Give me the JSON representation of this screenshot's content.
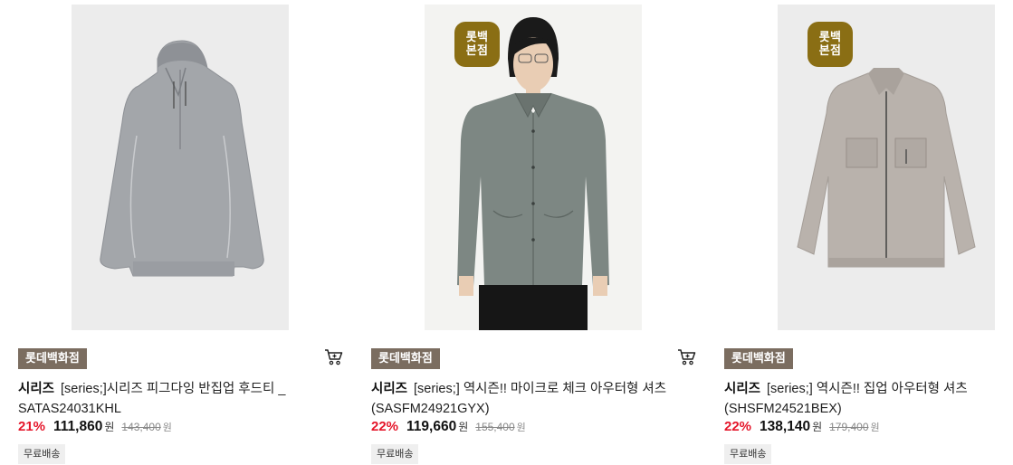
{
  "products": [
    {
      "store_badge": "",
      "seller": "롯데백화점",
      "brand": "시리즈",
      "name": "[series;]시리즈 피그다잉 반집업 후드티 _ SATAS24031KHL",
      "discount": "21%",
      "price": "111,860",
      "price_unit": "원",
      "original_price": "143,400",
      "original_unit": "원",
      "shipping": "무료배송"
    },
    {
      "store_badge": "롯백\n본점",
      "seller": "롯데백화점",
      "brand": "시리즈",
      "name": "[series;] 역시즌!! 마이크로 체크 아우터형 셔츠 (SASFM24921GYX)",
      "discount": "22%",
      "price": "119,660",
      "price_unit": "원",
      "original_price": "155,400",
      "original_unit": "원",
      "shipping": "무료배송"
    },
    {
      "store_badge": "롯백\n본점",
      "seller": "롯데백화점",
      "brand": "시리즈",
      "name": "[series;] 역시즌!! 집업 아우터형 셔츠 (SHSFM24521BEX)",
      "discount": "22%",
      "price": "138,140",
      "price_unit": "원",
      "original_price": "179,400",
      "original_unit": "원",
      "shipping": "무료배송"
    }
  ],
  "colors": {
    "badge": "#8a6e14",
    "seller_tag": "#7b6d60",
    "discount": "#e5162a"
  },
  "icons": {
    "cart": "cart-icon"
  }
}
